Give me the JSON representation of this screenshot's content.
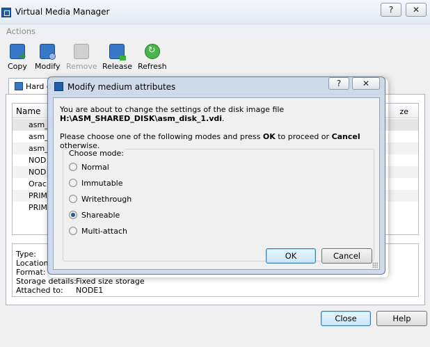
{
  "window": {
    "title": "Virtual Media Manager",
    "help_glyph": "?",
    "close_glyph": "✕"
  },
  "menu": {
    "actions": "Actions"
  },
  "toolbar": {
    "copy": "Copy",
    "modify": "Modify",
    "remove": "Remove",
    "release": "Release",
    "refresh": "Refresh"
  },
  "tabs": {
    "hard_disks": "Hard d"
  },
  "list": {
    "header_name": "Name",
    "header_size": "ze",
    "rows": [
      "asm_",
      "asm_",
      "asm_",
      "NOD",
      "NOD",
      "Orac",
      "PRIM",
      "PRIM"
    ]
  },
  "details": {
    "type_label": "Type:",
    "location_label": "Location:",
    "format_label": "Format:",
    "storage_label": "Storage details:",
    "storage_value": "Fixed size storage",
    "attached_label": "Attached to:",
    "attached_value": "NODE1"
  },
  "buttons": {
    "close": "Close",
    "help": "Help"
  },
  "dialog": {
    "title": "Modify medium attributes",
    "help_glyph": "?",
    "close_glyph": "✕",
    "message_prefix": "You are about to change the settings of the disk image file ",
    "message_path": "H:\\ASM_SHARED_DISK\\asm_disk_1.vdi",
    "message_suffix": ".",
    "instruction_prefix": "Please choose one of the following modes and press ",
    "instruction_ok": "OK",
    "instruction_middle": " to proceed or ",
    "instruction_cancel": "Cancel",
    "instruction_suffix": " otherwise.",
    "group_label": "Choose mode:",
    "modes": [
      {
        "label": "Normal",
        "checked": false
      },
      {
        "label": "Immutable",
        "checked": false
      },
      {
        "label": "Writethrough",
        "checked": false
      },
      {
        "label": "Shareable",
        "checked": true
      },
      {
        "label": "Multi-attach",
        "checked": false
      }
    ],
    "ok": "OK",
    "cancel": "Cancel"
  }
}
